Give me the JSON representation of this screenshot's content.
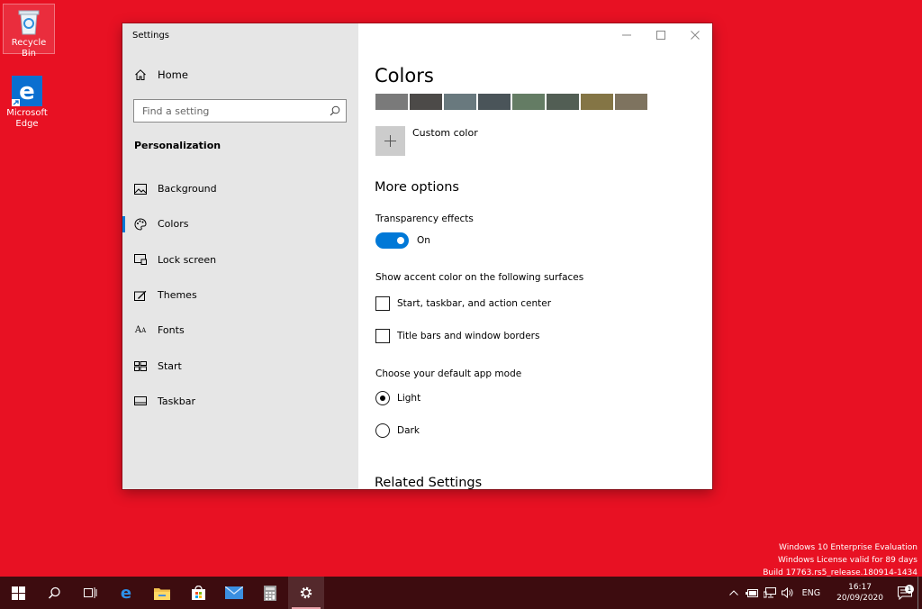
{
  "desktop": {
    "icons": [
      {
        "label": "Recycle Bin"
      },
      {
        "label": "Microsoft Edge"
      }
    ]
  },
  "window": {
    "title": "Settings",
    "sidebar": {
      "home_label": "Home",
      "search_placeholder": "Find a setting",
      "section_label": "Personalization",
      "items": [
        {
          "label": "Background",
          "icon": "image-icon"
        },
        {
          "label": "Colors",
          "icon": "palette-icon",
          "active": true
        },
        {
          "label": "Lock screen",
          "icon": "lock-screen-icon"
        },
        {
          "label": "Themes",
          "icon": "brush-icon"
        },
        {
          "label": "Fonts",
          "icon": "font-icon"
        },
        {
          "label": "Start",
          "icon": "start-grid-icon"
        },
        {
          "label": "Taskbar",
          "icon": "taskbar-icon"
        }
      ]
    },
    "content": {
      "page_title": "Colors",
      "swatches": [
        "#7a7a7a",
        "#4c4a48",
        "#69797e",
        "#4a5459",
        "#647c64",
        "#525e54",
        "#847545",
        "#7e735f"
      ],
      "custom_color_label": "Custom color",
      "more_options_title": "More options",
      "transparency_label": "Transparency effects",
      "transparency_state": "On",
      "accent_surfaces_label": "Show accent color on the following surfaces",
      "checkbox_start": "Start, taskbar, and action center",
      "checkbox_titlebars": "Title bars and window borders",
      "app_mode_label": "Choose your default app mode",
      "radio_light": "Light",
      "radio_dark": "Dark",
      "related_title": "Related Settings"
    }
  },
  "watermark": {
    "line1": "Windows 10 Enterprise Evaluation",
    "line2": "Windows License valid for 89 days",
    "line3": "Build 17763.rs5_release.180914-1434"
  },
  "taskbar": {
    "language": "ENG",
    "time": "16:17",
    "date": "20/09/2020",
    "notification_count": "1"
  },
  "colors": {
    "desktop_bg": "#e81123",
    "accent": "#0078d7",
    "taskbar_bg": "#3d0c0f"
  }
}
